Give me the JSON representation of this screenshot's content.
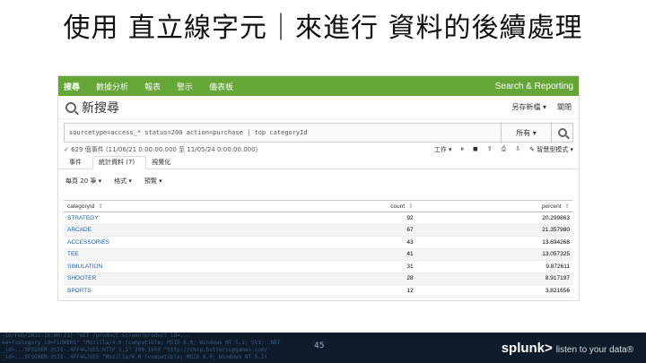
{
  "slide": {
    "title": "使用 直立線字元｜來進行 資料的後續處理",
    "page_number": "45"
  },
  "nav": {
    "items": [
      "搜尋",
      "數據分析",
      "報表",
      "警示",
      "儀表板"
    ],
    "app_name": "Search & Reporting"
  },
  "header": {
    "title": "新搜尋",
    "actions": [
      "另存新檔 ▾",
      "關閉"
    ]
  },
  "search": {
    "query": "sourcetype=access_* status=200 action=purchase | top categoryId",
    "time_range": "所有 ▾"
  },
  "status": {
    "text": "✓ 629 個事件 (11/06/21 0:00:00.000 至 11/05/24 0:00:00.000)",
    "tools": [
      "工作 ▾",
      "⏸",
      "◼",
      "⇪",
      "⎙",
      "⇩",
      "✎ 智慧型模式 ▾"
    ]
  },
  "tabs": [
    "事件",
    "統計資料 (7)",
    "視覺化"
  ],
  "options": [
    "每頁 20 筆 ▾",
    "格式 ▾",
    "預覽 ▾"
  ],
  "table": {
    "headers": [
      "categoryId",
      "count",
      "percent"
    ],
    "rows": [
      [
        "STRATEGY",
        "92",
        "20.299863"
      ],
      [
        "ARCADE",
        "67",
        "21.357980"
      ],
      [
        "ACCESSORIES",
        "43",
        "13.694268"
      ],
      [
        "TEE",
        "41",
        "13.057325"
      ],
      [
        "SIMULATION",
        "31",
        "9.872611"
      ],
      [
        "SHOOTER",
        "28",
        "8.917197"
      ],
      [
        "SPORTS",
        "12",
        "3.821656"
      ]
    ]
  },
  "footer": {
    "log_lines": [
      "-10/Feb/2011:16:00:21] \"GET /product.screen?product_id=...",
      "ew=?category_id=FLOWERS\" \"Mozilla/4.0 (compatible; MSIE 6.0; Windows NT 5.1; SV1; .NET",
      "_id=...SFSG9ER-3S55-.4FF4&JSES:HTTP 1.1\" 200 1659 \"http://shop.buttercupgames.com/",
      "_id=...SFSG9ER-3S55-.4FF4&JSES \"Mozilla/4.0 (compatible; MSIE 6.0; Windows NT 5.1)"
    ],
    "brand_logo": "splunk>",
    "brand_tagline": "listen to your data®"
  }
}
